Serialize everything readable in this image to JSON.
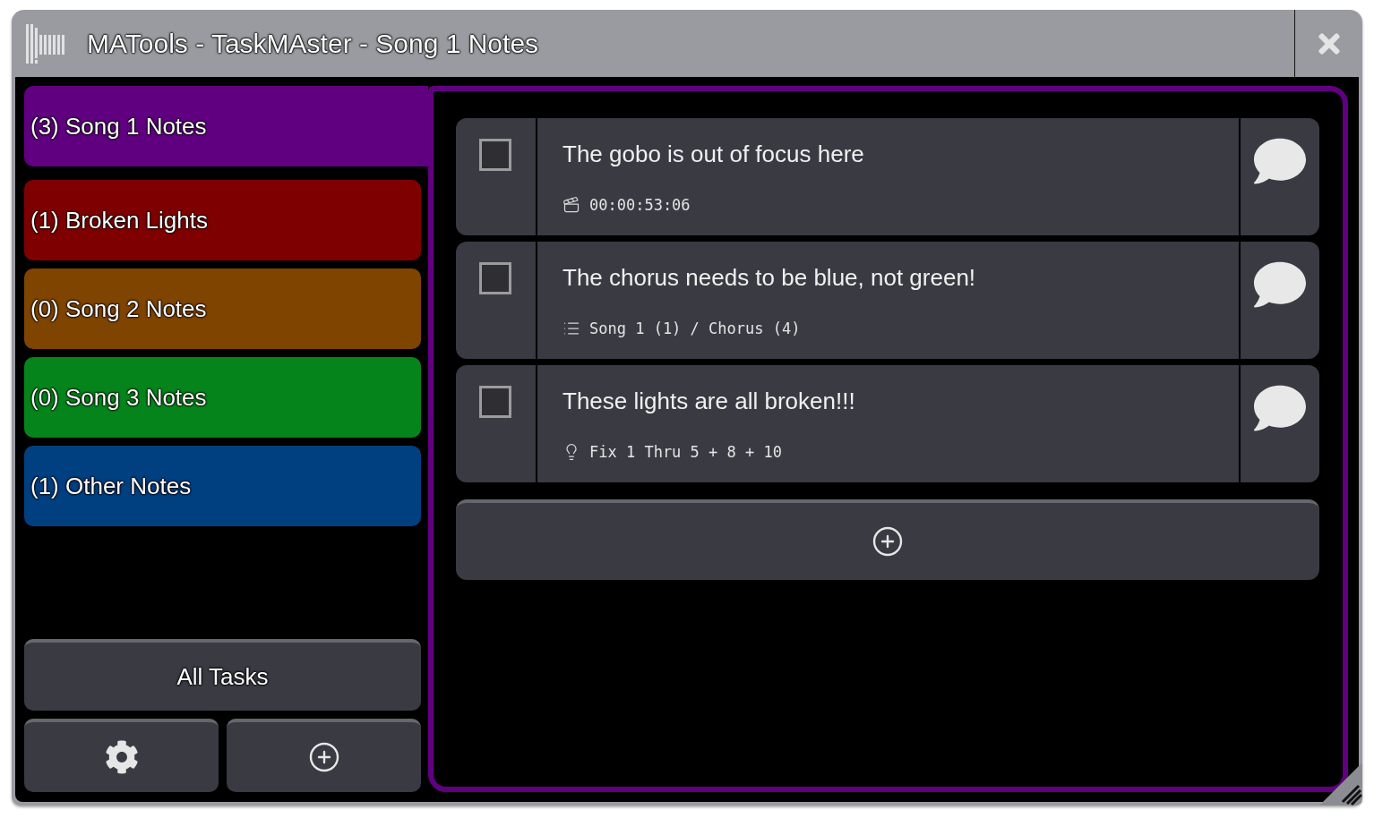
{
  "window": {
    "title": "MATools - TaskMAster - Song 1 Notes"
  },
  "sidebar": {
    "lists": [
      {
        "label": "(3) Song 1 Notes",
        "color": "#600080",
        "selected": true
      },
      {
        "label": "(1) Broken Lights",
        "color": "#7f0000",
        "selected": false
      },
      {
        "label": "(0) Song 2 Notes",
        "color": "#7f4400",
        "selected": false
      },
      {
        "label": "(0) Song 3 Notes",
        "color": "#06841c",
        "selected": false
      },
      {
        "label": "(1) Other Notes",
        "color": "#003f80",
        "selected": false
      }
    ],
    "all_tasks_button": "All Tasks"
  },
  "tasks": [
    {
      "title": "The gobo is out of focus here",
      "kind": "timecode",
      "detail": "00:00:53:06",
      "checked": false
    },
    {
      "title": "The chorus needs to be blue, not green!",
      "kind": "cue",
      "detail": "Song 1 (1) / Chorus (4)",
      "checked": false
    },
    {
      "title": "These lights are all broken!!!",
      "kind": "fixtures",
      "detail": "Fix 1 Thru 5 + 8 + 10",
      "checked": false
    }
  ]
}
